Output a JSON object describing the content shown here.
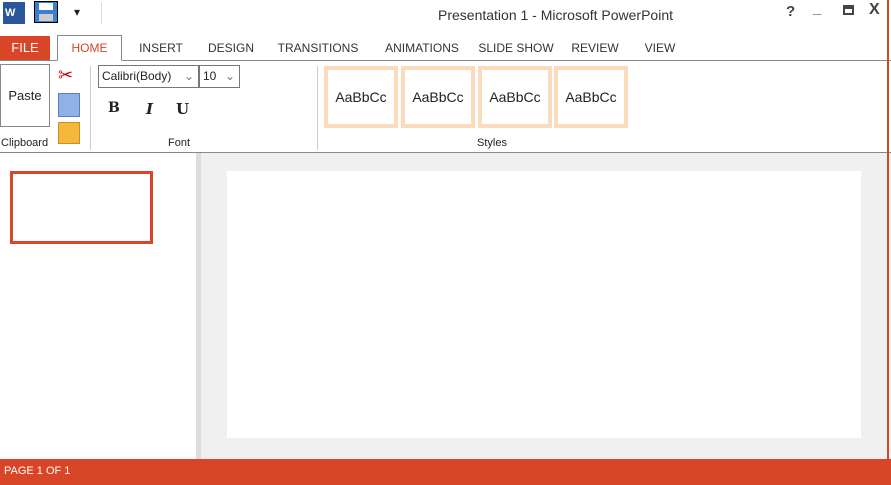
{
  "window": {
    "title": "Presentation 1 - Microsoft PowerPoint",
    "help": "?",
    "minimize": "_",
    "close": "X"
  },
  "quick_access": {
    "customize": "▾"
  },
  "tabs": [
    {
      "label": "FILE"
    },
    {
      "label": "HOME"
    },
    {
      "label": "INSERT"
    },
    {
      "label": "DESIGN"
    },
    {
      "label": "TRANSITIONS"
    },
    {
      "label": "ANIMATIONS"
    },
    {
      "label": "SLIDE SHOW"
    },
    {
      "label": "REVIEW"
    },
    {
      "label": "VIEW"
    }
  ],
  "clipboard": {
    "paste": "Paste",
    "group": "Clipboard"
  },
  "font": {
    "family": "Calibri(Body)",
    "size": "10",
    "bold": "B",
    "italic": "I",
    "underline": "U",
    "group": "Font"
  },
  "styles": {
    "items": [
      "AaBbCc",
      "AaBbCc",
      "AaBbCc",
      "AaBbCc"
    ],
    "group": "Styles"
  },
  "status": {
    "page": "PAGE 1 OF 1"
  },
  "colors": {
    "accent": "#d84627",
    "style_border": "#fcdbbc"
  }
}
